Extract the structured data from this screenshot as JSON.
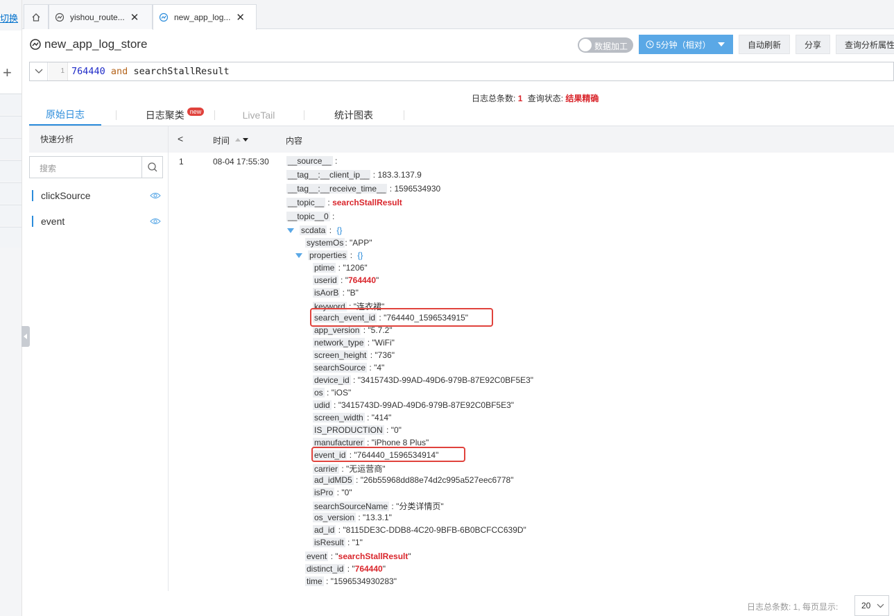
{
  "rail": {
    "switch_label": "切换"
  },
  "tabs": [
    {
      "title": "yishou_route..."
    },
    {
      "title": "new_app_log..."
    }
  ],
  "header": {
    "logstore_name": "new_app_log_store",
    "data_process_label": "数据加工",
    "time_range_label": "5分钟（相对）",
    "auto_refresh_label": "自动刷新",
    "share_label": "分享",
    "query_attr_label": "查询分析属性"
  },
  "query": {
    "line_number": "1",
    "tokens": {
      "num": "764440",
      "op": "and",
      "ident": "searchStallResult"
    }
  },
  "status": {
    "total_label": "日志总条数:",
    "total_value": "1",
    "state_label": "查询状态:",
    "state_value": "结果精确"
  },
  "subtabs": {
    "raw": "原始日志",
    "cluster": "日志聚类",
    "new_badge": "new",
    "livetail": "LiveTail",
    "chart": "统计图表"
  },
  "quick": {
    "title": "快速分析",
    "search_placeholder": "搜索",
    "fields": [
      "clickSource",
      "event"
    ]
  },
  "table": {
    "col_time": "时间",
    "col_content": "内容",
    "row": {
      "index": "1",
      "time": "08-04 17:55:30"
    }
  },
  "log": {
    "source_key": "__source__",
    "source_val": "",
    "client_ip_key": "__tag__:__client_ip__",
    "client_ip_val": "183.3.137.9",
    "receive_time_key": "__tag__:__receive_time__",
    "receive_time_val": "1596534930",
    "topic_key": "__topic__",
    "topic_val": "searchStallResult",
    "topic0_key": "__topic__0",
    "topic0_val": "",
    "scdata_key": "scdata",
    "brace": "{}",
    "systemOs_key": "systemOs",
    "systemOs_val": "\"APP\"",
    "properties_key": "properties",
    "props": {
      "ptime": "\"1206\"",
      "userid": "764440",
      "isAorB": "\"B\"",
      "keyword": "\"连衣裙\"",
      "search_event_id": "\"764440_1596534915\"",
      "app_version": "\"5.7.2\"",
      "network_type": "\"WiFi\"",
      "screen_height": "\"736\"",
      "searchSource": "\"4\"",
      "device_id": "\"3415743D-99AD-49D6-979B-87E92C0BF5E3\"",
      "os": "\"iOS\"",
      "udid": "\"3415743D-99AD-49D6-979B-87E92C0BF5E3\"",
      "screen_width": "\"414\"",
      "IS_PRODUCTION": "\"0\"",
      "manufacturer": "\"iPhone 8 Plus\"",
      "event_id": "\"764440_1596534914\"",
      "carrier": "\"无运营商\"",
      "ad_idMD5": "\"26b55968dd88e74d2c995a527eec6778\"",
      "isPro": "\"0\"",
      "searchSourceName": "\"分类详情页\"",
      "os_version": "\"13.3.1\"",
      "ad_id": "\"8115DE3C-DDB8-4C20-9BFB-6B0BCFCC639D\"",
      "isResult": "\"1\""
    },
    "event_val": "searchStallResult",
    "distinct_id_val": "764440",
    "time_val": "\"1596534930283\""
  },
  "footer": {
    "summary": "日志总条数: 1, 每页显示:",
    "page_size": "20"
  },
  "colors": {
    "accent": "#2b8cdb",
    "highlight_red": "#d9262c",
    "time_btn": "#5aa8e6"
  }
}
